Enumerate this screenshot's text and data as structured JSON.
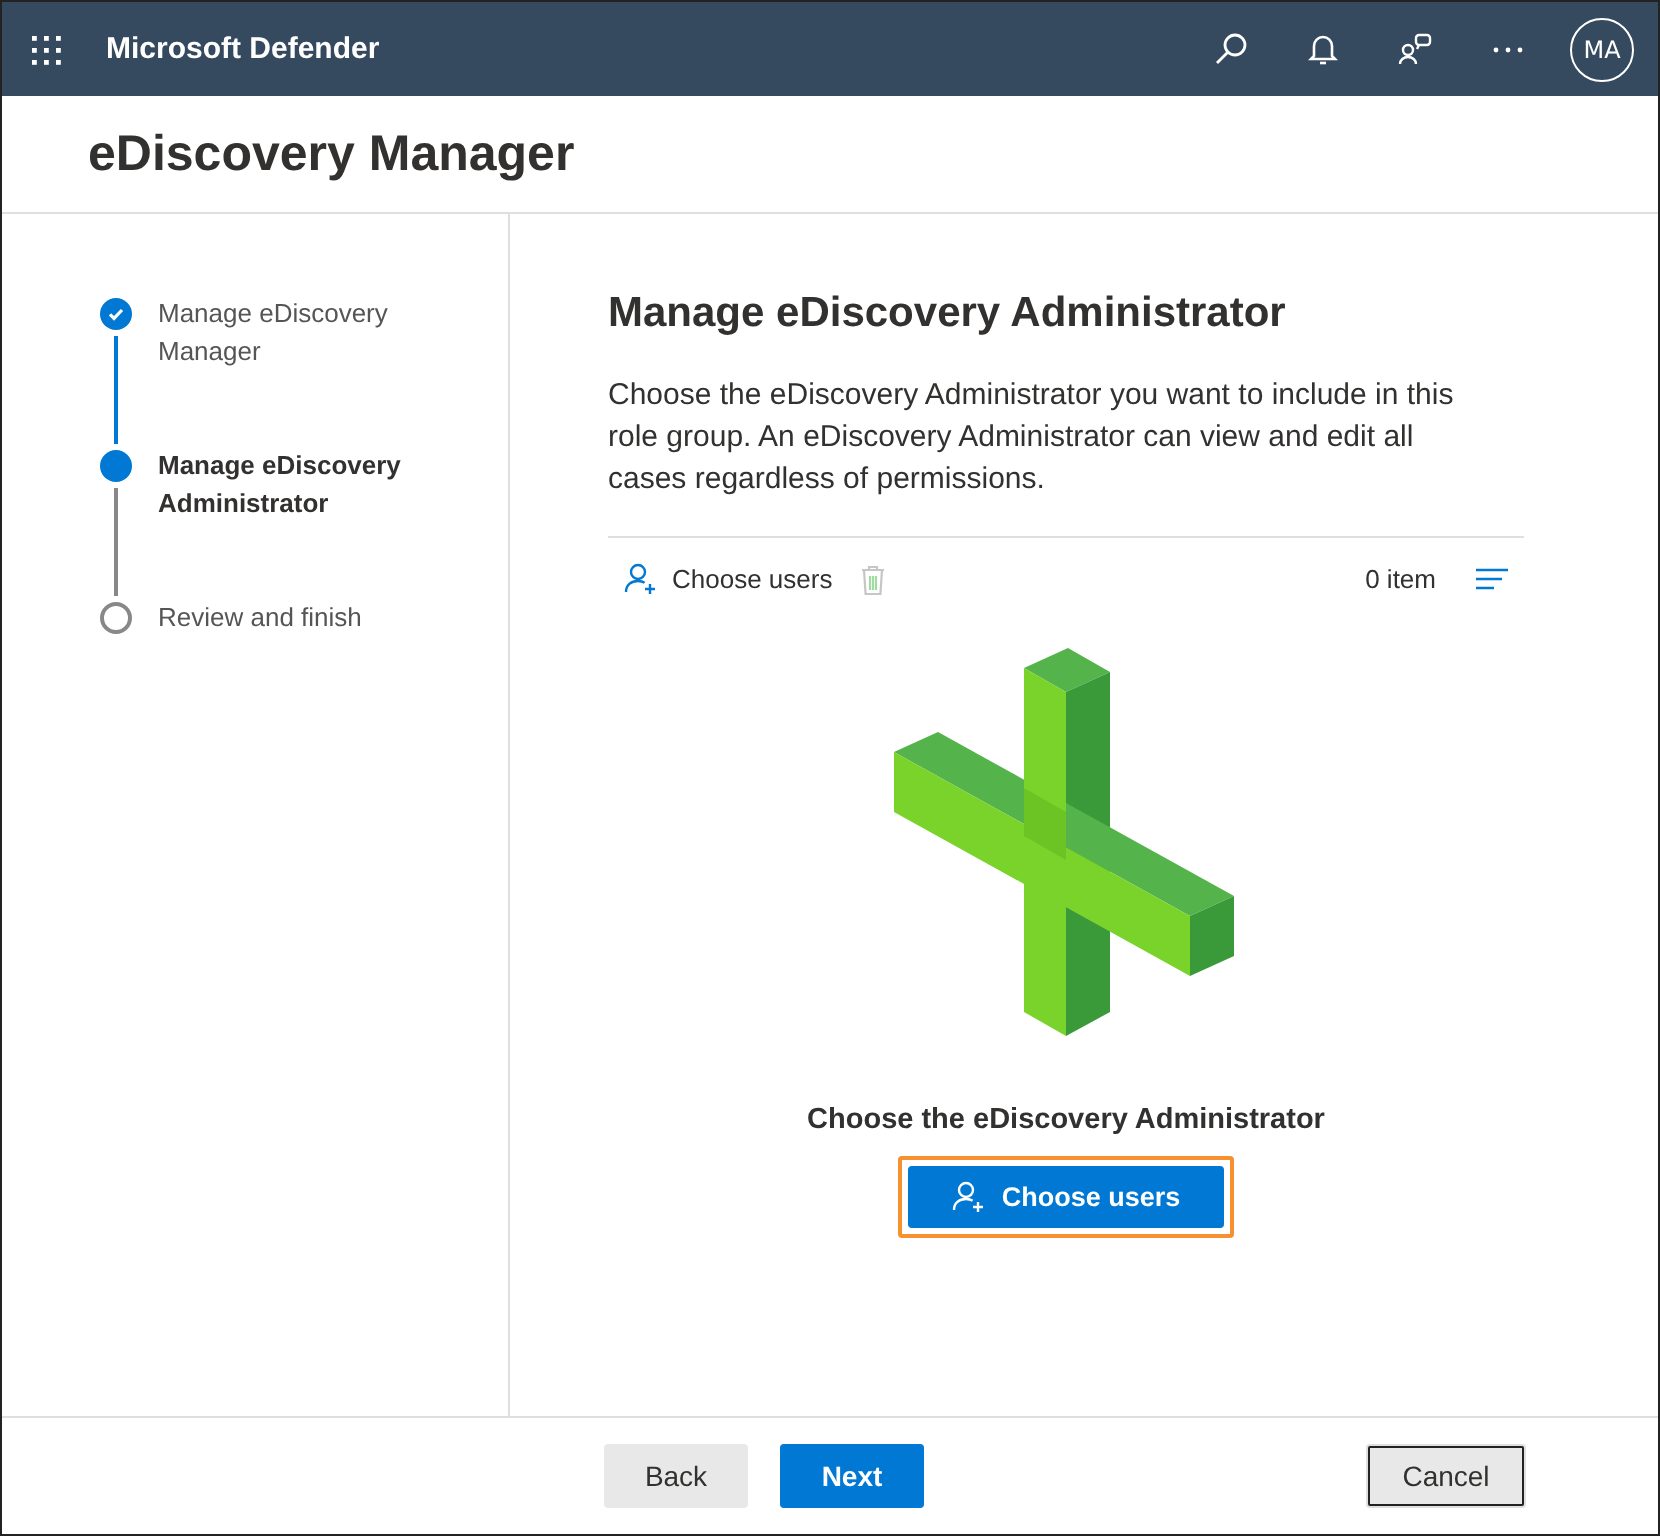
{
  "header": {
    "app_name": "Microsoft Defender",
    "avatar": "MA"
  },
  "page_title": "eDiscovery Manager",
  "steps": [
    {
      "label": "Manage eDiscovery Manager",
      "completed": true,
      "selected": false
    },
    {
      "label": "Manage eDiscovery Administrator",
      "completed": false,
      "selected": true
    },
    {
      "label": "Review and finish",
      "completed": false,
      "selected": false
    }
  ],
  "content": {
    "heading": "Manage eDiscovery Administrator",
    "description": "Choose the eDiscovery Administrator you want to include in this role group. An eDiscovery Administrator can view and edit all cases regardless of permissions.",
    "toolbar": {
      "choose_label": "Choose users",
      "delete_disabled": true,
      "count": "0 item"
    },
    "empty_title": "Choose the eDiscovery Administrator",
    "empty_button": "Choose users",
    "empty_button_focused": true
  },
  "footer_buttons": [
    {
      "label": "Back",
      "kind": "secondary",
      "focused": false
    },
    {
      "label": "Next",
      "kind": "primary",
      "focused": false
    },
    {
      "label": "Cancel",
      "kind": "secondary",
      "focused": true
    }
  ]
}
